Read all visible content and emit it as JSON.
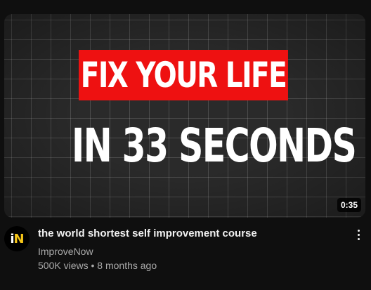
{
  "thumbnail": {
    "headline_red": "FIX YOUR LIFE",
    "headline_white": "IN 33 SECONDS",
    "duration": "0:35"
  },
  "video": {
    "title": "the world shortest self improvement course",
    "channel": "ImproveNow",
    "views": "500K views",
    "separator": "•",
    "age": "8 months ago"
  },
  "avatar": {
    "letter_i": "i",
    "letter_n": "N"
  },
  "colors": {
    "background": "#0f0f0f",
    "headline_red_bg": "#ee1111",
    "avatar_accent": "#f5c518",
    "secondary_text": "#aaaaaa"
  },
  "icons": {
    "more": "more-vert-icon"
  }
}
